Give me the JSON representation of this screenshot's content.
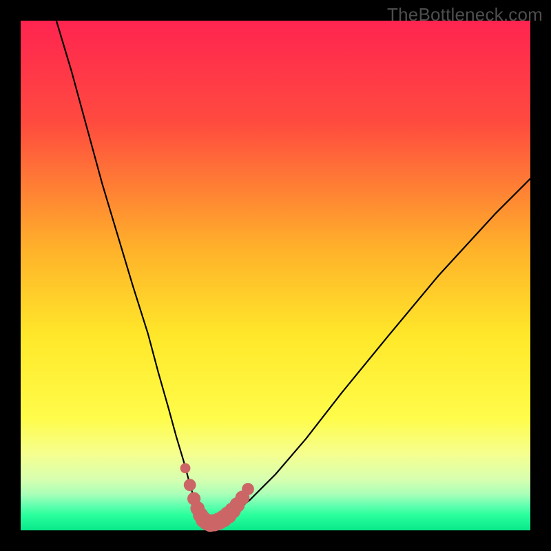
{
  "watermark": {
    "text": "TheBottleneck.com"
  },
  "colors": {
    "background_black": "#000000",
    "gradient_stops": [
      {
        "offset": 0,
        "color": "#ff2450"
      },
      {
        "offset": 20,
        "color": "#ff4b3f"
      },
      {
        "offset": 45,
        "color": "#ffb22a"
      },
      {
        "offset": 62,
        "color": "#ffe82a"
      },
      {
        "offset": 78,
        "color": "#fffc4a"
      },
      {
        "offset": 85,
        "color": "#f6ff8f"
      },
      {
        "offset": 90,
        "color": "#d7ffb0"
      },
      {
        "offset": 93,
        "color": "#a8ffb8"
      },
      {
        "offset": 95,
        "color": "#66ffb0"
      },
      {
        "offset": 97,
        "color": "#2bff9d"
      },
      {
        "offset": 100,
        "color": "#07e98a"
      }
    ],
    "curve_stroke": "#000000",
    "marker_fill": "#cc6666",
    "marker_stroke": "#803838"
  },
  "chart_data": {
    "type": "line",
    "title": "",
    "xlabel": "",
    "ylabel": "",
    "xlim": [
      0,
      100
    ],
    "ylim": [
      0,
      100
    ],
    "grid": false,
    "legend": false,
    "series": [
      {
        "name": "bottleneck-curve",
        "x": [
          7,
          10,
          13,
          16,
          19,
          22,
          25,
          27,
          29,
          30.5,
          32,
          33,
          33.8,
          34.5,
          35,
          35.4,
          35.8,
          36.2,
          36.8,
          37.5,
          38.5,
          40,
          42,
          45,
          50,
          56,
          63,
          72,
          82,
          93,
          100
        ],
        "values": [
          100,
          90,
          79,
          68,
          58,
          48,
          38.5,
          31,
          24,
          18.5,
          13.5,
          9.8,
          7,
          5,
          3.7,
          2.8,
          2.1,
          1.7,
          1.5,
          1.5,
          1.7,
          2.3,
          3.6,
          6,
          11,
          18,
          27,
          38,
          50,
          62,
          69
        ]
      }
    ],
    "markers": [
      {
        "x": 32.3,
        "y": 12.2,
        "r": 1.0
      },
      {
        "x": 33.2,
        "y": 8.9,
        "r": 1.2
      },
      {
        "x": 34.0,
        "y": 6.2,
        "r": 1.3
      },
      {
        "x": 34.7,
        "y": 4.3,
        "r": 1.4
      },
      {
        "x": 35.3,
        "y": 3.0,
        "r": 1.5
      },
      {
        "x": 35.9,
        "y": 2.1,
        "r": 1.6
      },
      {
        "x": 36.5,
        "y": 1.6,
        "r": 1.6
      },
      {
        "x": 37.2,
        "y": 1.4,
        "r": 1.7
      },
      {
        "x": 38.0,
        "y": 1.5,
        "r": 1.7
      },
      {
        "x": 38.9,
        "y": 1.8,
        "r": 1.7
      },
      {
        "x": 39.8,
        "y": 2.3,
        "r": 1.7
      },
      {
        "x": 40.7,
        "y": 3.0,
        "r": 1.7
      },
      {
        "x": 41.6,
        "y": 3.9,
        "r": 1.6
      },
      {
        "x": 42.5,
        "y": 5.0,
        "r": 1.5
      },
      {
        "x": 43.5,
        "y": 6.4,
        "r": 1.4
      },
      {
        "x": 44.6,
        "y": 8.1,
        "r": 1.2
      }
    ]
  }
}
